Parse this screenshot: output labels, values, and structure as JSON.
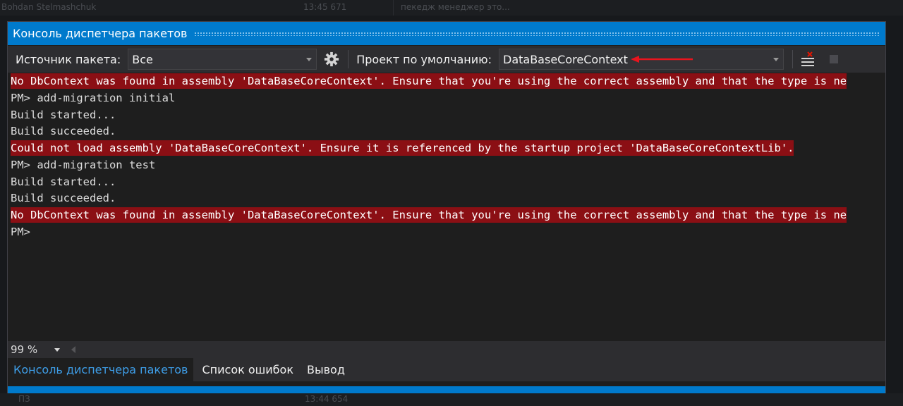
{
  "background": {
    "top_left_text": "Bohdan Stelmashchuk",
    "top_time_text": "13:45 671",
    "top_right_text": "пекедж менеджер это...",
    "bottom_left_text": "ПЗ",
    "bottom_time_text": "13:44 654"
  },
  "window": {
    "title": "Консоль диспетчера пакетов"
  },
  "toolbar": {
    "source_label": "Источник пакета:",
    "source_value": "Все",
    "project_label": "Проект по умолчанию:",
    "project_value": "DataBaseCoreContext"
  },
  "console": {
    "lines": [
      {
        "text": "No DbContext was found in assembly 'DataBaseCoreContext'. Ensure that you're using the correct assembly and that the type is ne",
        "type": "error"
      },
      {
        "text": "PM> add-migration initial",
        "type": "normal"
      },
      {
        "text": "Build started...",
        "type": "normal"
      },
      {
        "text": "Build succeeded.",
        "type": "normal"
      },
      {
        "text": "Could not load assembly 'DataBaseCoreContext'. Ensure it is referenced by the startup project 'DataBaseCoreContextLib'.",
        "type": "error"
      },
      {
        "text": "PM> add-migration test",
        "type": "normal"
      },
      {
        "text": "Build started...",
        "type": "normal"
      },
      {
        "text": "Build succeeded.",
        "type": "normal"
      },
      {
        "text": "No DbContext was found in assembly 'DataBaseCoreContext'. Ensure that you're using the correct assembly and that the type is ne",
        "type": "error"
      },
      {
        "text": "PM>",
        "type": "normal"
      }
    ]
  },
  "status": {
    "zoom": "99 %"
  },
  "tabs": [
    {
      "label": "Консоль диспетчера пакетов",
      "active": true
    },
    {
      "label": "Список ошибок",
      "active": false
    },
    {
      "label": "Вывод",
      "active": false
    }
  ],
  "colors": {
    "accent": "#007acc",
    "error_bg": "#8b0f14",
    "annotation_arrow": "#e8141e"
  },
  "icons": {
    "settings": "gear-icon",
    "clear": "clear-console-icon",
    "stop": "stop-icon"
  }
}
